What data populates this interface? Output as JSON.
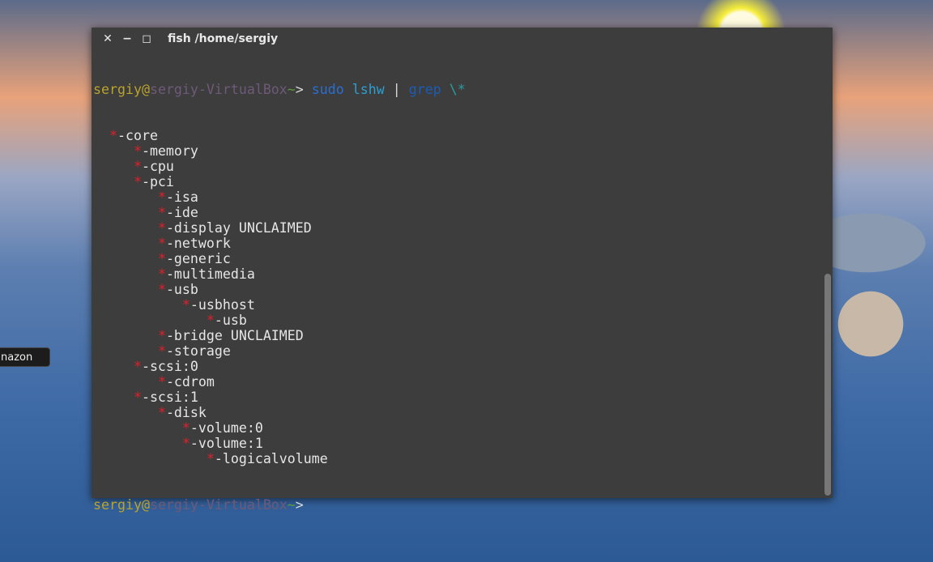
{
  "desktop": {
    "launcher_label": "nazon"
  },
  "window": {
    "title": "fish  /home/sergiy",
    "close": "✕",
    "minimize": "−",
    "maximize": "◻"
  },
  "prompt": {
    "user": "sergiy",
    "at": "@",
    "host": "sergiy-VirtualBox",
    "tilde": "~",
    "arrow": ">"
  },
  "command": {
    "sudo": "sudo",
    "lshw": "lshw",
    "pipe": "|",
    "grep": "grep",
    "arg": "\\*"
  },
  "output": [
    {
      "level": 1,
      "text": "-core"
    },
    {
      "level": 2,
      "text": "-memory"
    },
    {
      "level": 2,
      "text": "-cpu"
    },
    {
      "level": 2,
      "text": "-pci"
    },
    {
      "level": 3,
      "text": "-isa"
    },
    {
      "level": 3,
      "text": "-ide"
    },
    {
      "level": 3,
      "text": "-display UNCLAIMED"
    },
    {
      "level": 3,
      "text": "-network"
    },
    {
      "level": 3,
      "text": "-generic"
    },
    {
      "level": 3,
      "text": "-multimedia"
    },
    {
      "level": 3,
      "text": "-usb"
    },
    {
      "level": 4,
      "text": "-usbhost"
    },
    {
      "level": 5,
      "text": "-usb"
    },
    {
      "level": 3,
      "text": "-bridge UNCLAIMED"
    },
    {
      "level": 3,
      "text": "-storage"
    },
    {
      "level": 2,
      "text": "-scsi:0"
    },
    {
      "level": 3,
      "text": "-cdrom"
    },
    {
      "level": 2,
      "text": "-scsi:1"
    },
    {
      "level": 3,
      "text": "-disk"
    },
    {
      "level": 4,
      "text": "-volume:0"
    },
    {
      "level": 4,
      "text": "-volume:1"
    },
    {
      "level": 5,
      "text": "-logicalvolume"
    }
  ],
  "star": "*"
}
